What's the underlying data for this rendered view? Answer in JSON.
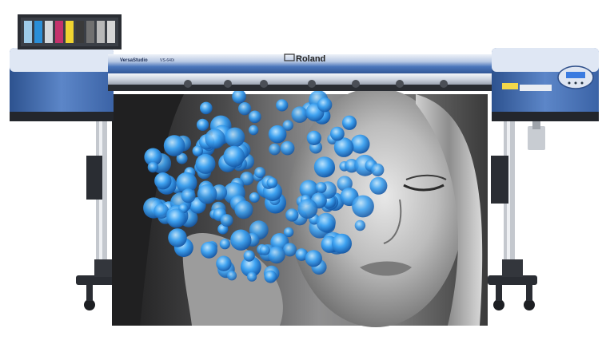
{
  "printer": {
    "brand": "Roland",
    "series_label": "VersaStudio",
    "model_label": "VS-640i"
  },
  "ink": {
    "cartridge_colors": [
      "#9ecbe8",
      "#2a8fd8",
      "#d4d8dc",
      "#c4326c",
      "#f0d430",
      "#3a3a3a",
      "#707070",
      "#b8b8b8",
      "#d6d6d6"
    ]
  },
  "colors": {
    "body_blue": "#3f6db3",
    "body_blue_light": "#8fb2e0",
    "frame_dark": "#2a2d33",
    "hydrangea": "#2f8fe0"
  }
}
